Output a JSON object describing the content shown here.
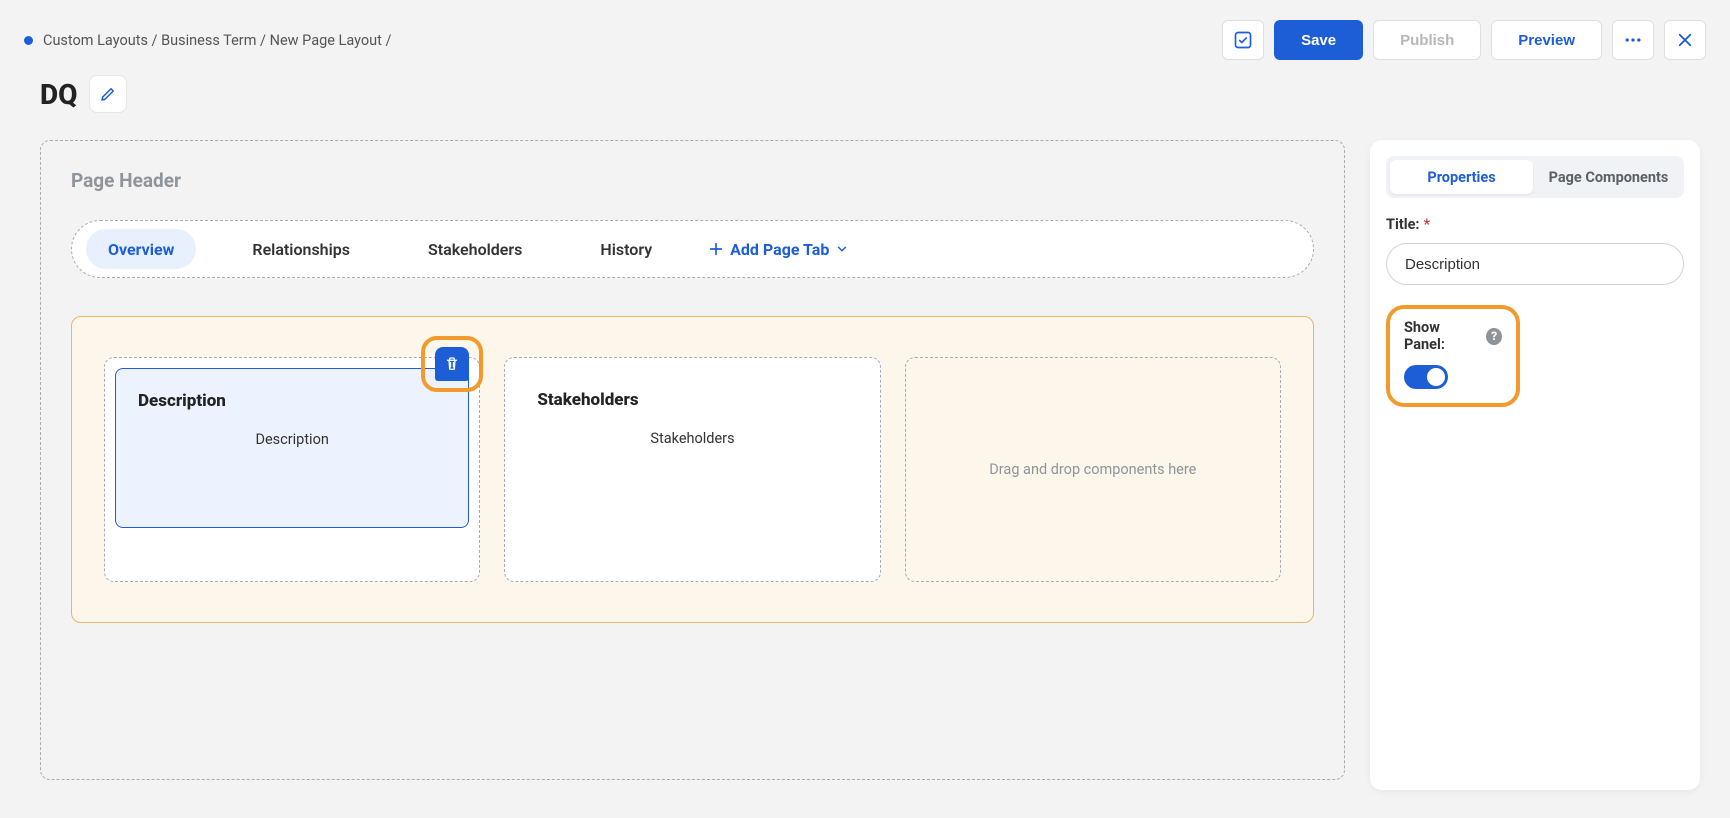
{
  "breadcrumb": {
    "a": "Custom Layouts",
    "b": "Business Term",
    "c": "New Page Layout"
  },
  "actions": {
    "save": "Save",
    "publish": "Publish",
    "preview": "Preview"
  },
  "title": "DQ",
  "page_header": {
    "label": "Page Header"
  },
  "tabs": {
    "overview": "Overview",
    "relationships": "Relationships",
    "stakeholders": "Stakeholders",
    "history": "History",
    "add": "Add Page Tab"
  },
  "columns": {
    "c1": {
      "title": "Description",
      "body": "Description"
    },
    "c2": {
      "title": "Stakeholders",
      "body": "Stakeholders"
    },
    "drop": "Drag and drop components here"
  },
  "side": {
    "tab_properties": "Properties",
    "tab_components": "Page Components",
    "title_label": "Title:",
    "title_value": "Description",
    "show_panel_label": "Show Panel:"
  }
}
